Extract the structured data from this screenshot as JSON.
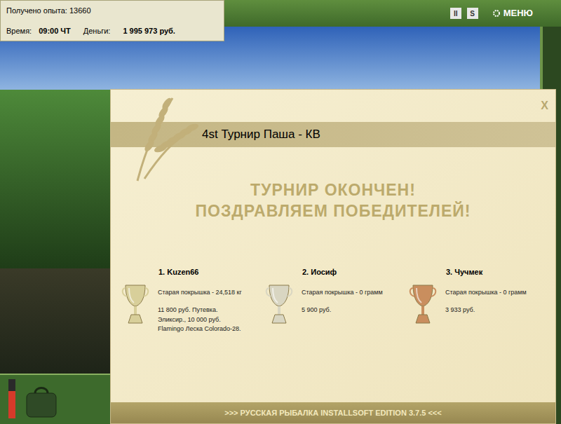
{
  "hud": {
    "experience": "Получено опыта: 13660",
    "time_label": "Время:",
    "time": "09:00 ЧТ",
    "money_label": "Деньги:",
    "money": "1 995 973 руб.",
    "meter_level": 0.7
  },
  "toolbar": {
    "pause": "II",
    "sound": "S",
    "menu": "МЕНЮ"
  },
  "dialog": {
    "close": "X",
    "title": "4st Турнир Паша - КВ",
    "heading": [
      "ТУРНИР ОКОНЧЕН!",
      "ПОЗДРАВЛЯЕМ ПОБЕДИТЕЛЕЙ!"
    ],
    "winners": [
      {
        "place": "1. Kuzen66",
        "catch": "Старая покрышка - 24,518 кг",
        "prizes": [
          "11 800 руб. Путевка.",
          "Эликсир., 10 000 руб.",
          "Flamingo Леска Colorado-28."
        ],
        "color": "#d8cf9a"
      },
      {
        "place": "2. Иосиф",
        "catch": "Старая покрышка - 0 грамм",
        "prizes": [
          "5 900 руб."
        ],
        "color": "#d9d6c2"
      },
      {
        "place": "3. Чучмек",
        "catch": "Старая покрышка - 0 грамм",
        "prizes": [
          "3 933 руб."
        ],
        "color": "#c98e5e"
      }
    ],
    "footer": ">>> РУССКАЯ РЫБАЛКА INSTALLSOFT EDITION 3.7.5 <<<"
  }
}
